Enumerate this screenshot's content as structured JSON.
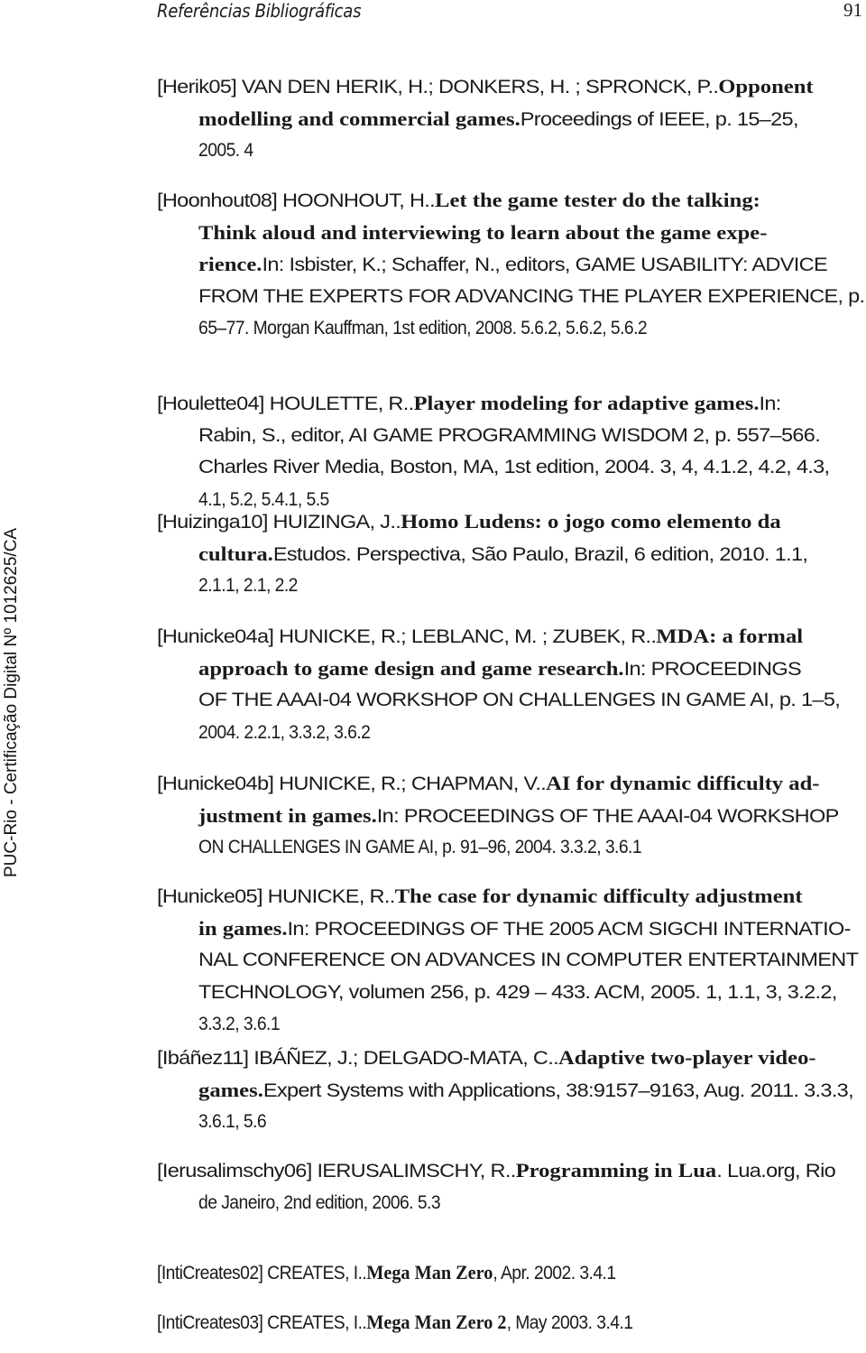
{
  "header": {
    "title": "Referências Bibliográficas",
    "page_number": "91"
  },
  "watermark": "PUC-Rio - Certificação Digital Nº 1012625/CA",
  "entries": [
    {
      "key": "Herik05",
      "lines": [
        [
          "[Herik05] VAN DEN HERIK, H.; DONKERS, H. ; SPRONCK, P.. ",
          "Opponent",
          ""
        ],
        [
          "",
          "modelling and commercial games.",
          " Proceedings of IEEE, p. 15–25,"
        ],
        [
          "2005. 4",
          "",
          ""
        ]
      ]
    },
    {
      "key": "Hoonhout08",
      "lines": [
        [
          "[Hoonhout08] HOONHOUT, H..  ",
          "Let the game tester do the talking:",
          ""
        ],
        [
          "",
          "Think aloud and interviewing to learn about the game expe-",
          ""
        ],
        [
          "",
          "rience.",
          " In: Isbister, K.; Schaffer, N., editors, GAME USABILITY: ADVICE"
        ],
        [
          "FROM THE EXPERTS FOR ADVANCING THE PLAYER EXPERIENCE, p.",
          "",
          ""
        ],
        [
          "65–77. Morgan Kauffman, 1st edition, 2008. 5.6.2, 5.6.2, 5.6.2",
          "",
          ""
        ]
      ]
    },
    {
      "key": "Houlette04",
      "lines": [
        [
          "[Houlette04] HOULETTE, R..  ",
          "Player modeling for adaptive games.",
          "  In:"
        ],
        [
          "Rabin, S., editor, AI GAME PROGRAMMING WISDOM 2, p. 557–566.",
          "",
          ""
        ],
        [
          "Charles River Media, Boston, MA, 1st edition, 2004.  3, 4, 4.1.2, 4.2, 4.3,",
          "",
          ""
        ],
        [
          "4.1, 5.2, 5.4.1, 5.5",
          "",
          ""
        ]
      ]
    },
    {
      "key": "Huizinga10",
      "lines": [
        [
          "[Huizinga10] HUIZINGA, J..  ",
          "Homo Ludens: o jogo como elemento da",
          ""
        ],
        [
          "",
          "cultura.",
          "  Estudos. Perspectiva, São Paulo, Brazil, 6 edition, 2010.  1.1,"
        ],
        [
          "2.1.1, 2.1, 2.2",
          "",
          ""
        ]
      ]
    },
    {
      "key": "Hunicke04a",
      "lines": [
        [
          "[Hunicke04a] HUNICKE, R.; LEBLANC, M. ; ZUBEK, R..  ",
          "MDA: a formal",
          ""
        ],
        [
          "",
          "approach to game design and game research.",
          "  In: PROCEEDINGS"
        ],
        [
          "OF THE AAAI-04 WORKSHOP ON CHALLENGES IN GAME AI, p. 1–5,",
          "",
          ""
        ],
        [
          "2004. 2.2.1, 3.3.2, 3.6.2",
          "",
          ""
        ]
      ]
    },
    {
      "key": "Hunicke04b",
      "lines": [
        [
          "[Hunicke04b] HUNICKE, R.; CHAPMAN, V.. ",
          "AI for dynamic difficulty ad-",
          ""
        ],
        [
          "",
          "justment in games.",
          " In: PROCEEDINGS OF THE AAAI-04 WORKSHOP"
        ],
        [
          "ON CHALLENGES IN GAME AI, p. 91–96, 2004. 3.3.2, 3.6.1",
          "",
          ""
        ]
      ]
    },
    {
      "key": "Hunicke05",
      "lines": [
        [
          "[Hunicke05] HUNICKE, R.. ",
          "The case for dynamic difficulty adjustment",
          ""
        ],
        [
          "",
          "in games.",
          " In: PROCEEDINGS OF THE 2005 ACM SIGCHI INTERNATIO-"
        ],
        [
          "NAL CONFERENCE ON ADVANCES IN COMPUTER ENTERTAINMENT",
          "",
          ""
        ],
        [
          "TECHNOLOGY, volumen 256, p. 429 – 433. ACM, 2005.  1, 1.1, 3, 3.2.2,",
          "",
          ""
        ],
        [
          "3.3.2, 3.6.1",
          "",
          ""
        ]
      ]
    },
    {
      "key": "Ibáñez11",
      "lines": [
        [
          "[Ibáñez11] IBÁÑEZ, J.; DELGADO-MATA, C.. ",
          "Adaptive two-player video-",
          ""
        ],
        [
          "",
          "games.",
          " Expert Systems with Applications, 38:9157–9163, Aug. 2011. 3.3.3,"
        ],
        [
          "3.6.1, 5.6",
          "",
          ""
        ]
      ]
    },
    {
      "key": "Ierusalimschy06",
      "lines": [
        [
          "[Ierusalimschy06] IERUSALIMSCHY, R.. ",
          "Programming in Lua",
          ". Lua.org, Rio"
        ],
        [
          "de Janeiro, 2nd edition, 2006. 5.3",
          "",
          ""
        ]
      ]
    },
    {
      "key": "IntiCreates02",
      "lines": [
        [
          "[IntiCreates02] CREATES, I.. ",
          "Mega Man Zero",
          ", Apr. 2002. 3.4.1"
        ]
      ]
    },
    {
      "key": "IntiCreates03",
      "lines": [
        [
          "[IntiCreates03] CREATES, I.. ",
          "Mega Man Zero 2",
          ", May 2003. 3.4.1"
        ]
      ]
    }
  ]
}
